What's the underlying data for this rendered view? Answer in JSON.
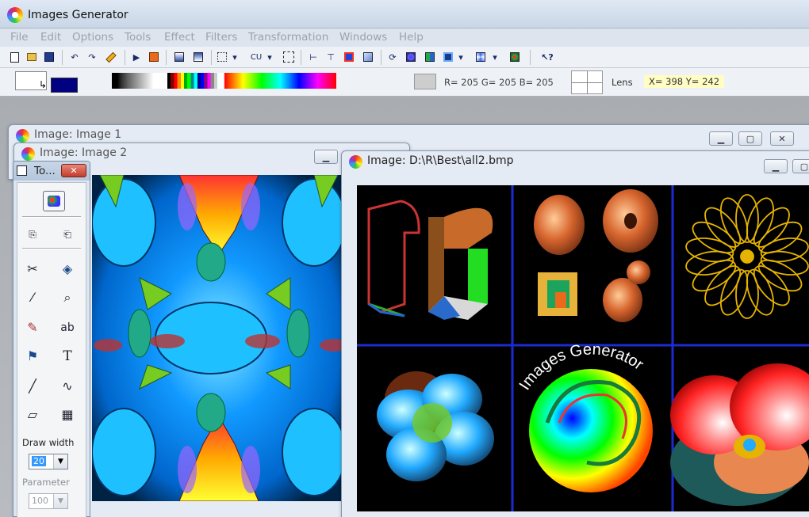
{
  "app": {
    "title": "Images Generator"
  },
  "menu": {
    "items": [
      "File",
      "Edit",
      "Options",
      "Tools",
      "Effect",
      "Filters",
      "Transformation",
      "Windows",
      "Help"
    ]
  },
  "toolbar": {
    "icons": [
      "new-file-icon",
      "open-folder-icon",
      "save-icon",
      "undo-icon",
      "redo-icon",
      "brush-icon",
      "run-icon",
      "paint-icon",
      "gradient-icon",
      "text-icon",
      "select-icon",
      "crop-icon",
      "rectangle-icon",
      "resize-width-icon",
      "resize-height-icon",
      "color-fill-icon",
      "image-icon",
      "refresh-icon",
      "pattern-icon",
      "mirror-icon",
      "frame-icon",
      "kaleidoscope-icon",
      "filter-icon",
      "help-pointer-icon"
    ],
    "cu_label": "CU"
  },
  "status": {
    "rgb": "R= 205  G= 205  B= 205",
    "lens_label": "Lens",
    "coords": "X= 398  Y= 242",
    "primary_color": "#ffffff",
    "secondary_color": "#000080",
    "picked_color": "#cdcdcd"
  },
  "windows": {
    "image1_title": "Image: Image 1",
    "image2_title": "Image: Image 2",
    "image3_title": "Image: D:\\R\\Best\\all2.bmp"
  },
  "tools_panel": {
    "title": "To...",
    "draw_width_label": "Draw width",
    "draw_width_value": "20",
    "parameter_label": "Parameter",
    "parameter_value": "100"
  },
  "gallery": {
    "logo_text": "Images Generator"
  }
}
